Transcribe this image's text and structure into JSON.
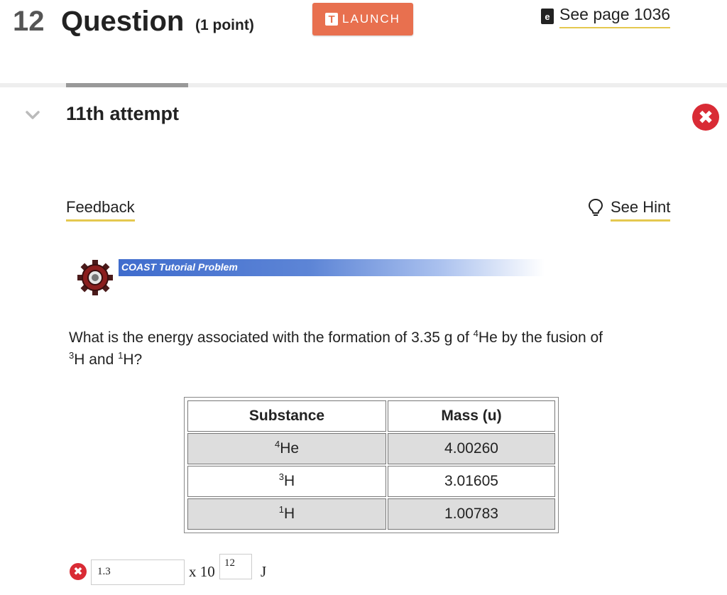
{
  "header": {
    "question_number": "12",
    "question_word": "Question",
    "points": "(1 point)",
    "launch_label": "LAUNCH",
    "launch_icon": "T",
    "see_page": "See page 1036"
  },
  "attempt": {
    "label": "11th attempt",
    "status": "incorrect"
  },
  "links": {
    "feedback": "Feedback",
    "hint": "See Hint"
  },
  "banner": {
    "label": "COAST Tutorial Problem"
  },
  "question": {
    "part1": "What is the energy associated with the formation of 3.35 g of ",
    "sup1": "4",
    "part2": "He by the fusion of ",
    "sup2": "3",
    "part3": "H and ",
    "sup3": "1",
    "part4": "H?"
  },
  "table": {
    "headers": [
      "Substance",
      "Mass (u)"
    ],
    "rows": [
      {
        "sup": "4",
        "symbol": "He",
        "mass": "4.00260"
      },
      {
        "sup": "3",
        "symbol": "H",
        "mass": "3.01605"
      },
      {
        "sup": "1",
        "symbol": "H",
        "mass": "1.00783"
      }
    ]
  },
  "answer": {
    "mantissa": "1.3",
    "times_label": "x 10",
    "exponent": "12",
    "unit": "J"
  },
  "colors": {
    "launch": "#e8704f",
    "error": "#d92b35",
    "underline": "#e5c84f",
    "banner": "#3f6ccd"
  },
  "icons": {
    "book": "book-icon",
    "chevron": "chevron-down-icon",
    "error": "close-circle-icon",
    "hint": "lightbulb-icon",
    "gear": "gear-icon"
  }
}
